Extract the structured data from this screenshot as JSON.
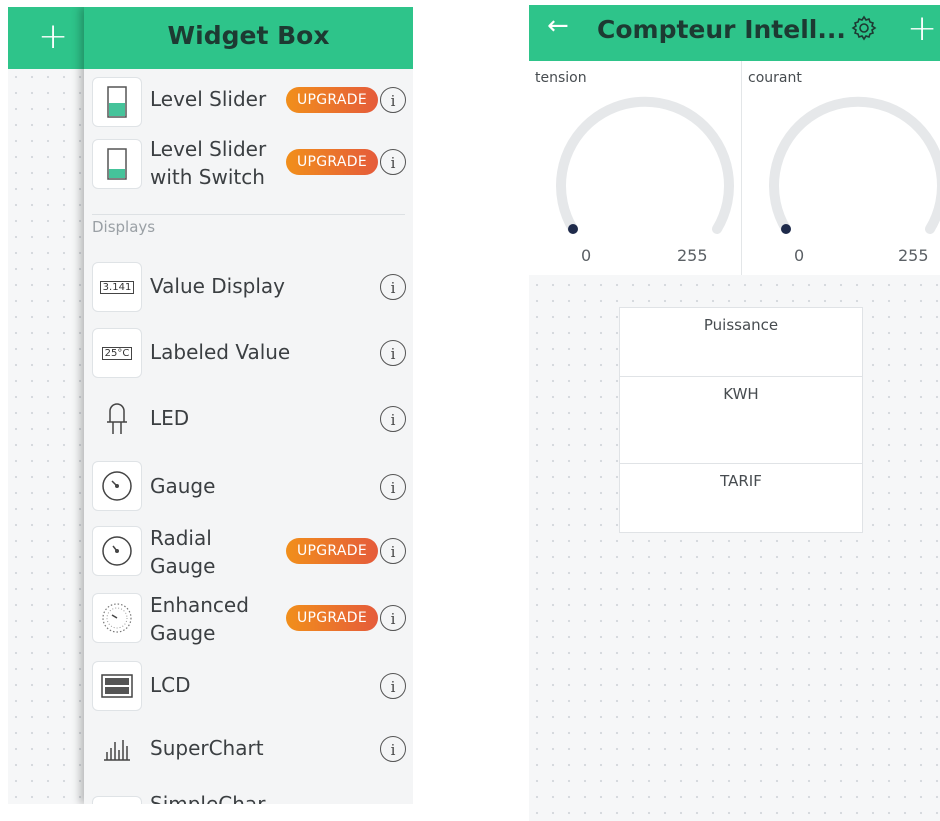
{
  "widget_box": {
    "title": "Widget Box",
    "section_displays": "Displays",
    "widgets": [
      {
        "icon": "level-slider-icon",
        "label": "Level Slider",
        "badge": "UPGRADE"
      },
      {
        "icon": "level-slider-switch-icon",
        "label": "Level Slider\nwith Switch",
        "badge": "UPGRADE"
      },
      {
        "icon": "value-display-icon",
        "icon_text": "3.141",
        "label": "Value Display",
        "badge": ""
      },
      {
        "icon": "labeled-value-icon",
        "icon_text": "25°C",
        "label": "Labeled Value",
        "badge": ""
      },
      {
        "icon": "led-icon",
        "label": "LED",
        "badge": ""
      },
      {
        "icon": "gauge-icon",
        "label": "Gauge",
        "badge": ""
      },
      {
        "icon": "radial-gauge-icon",
        "label": "Radial\nGauge",
        "badge": "UPGRADE"
      },
      {
        "icon": "enhanced-gauge-icon",
        "label": "Enhanced\nGauge",
        "badge": "UPGRADE"
      },
      {
        "icon": "lcd-icon",
        "label": "LCD",
        "badge": ""
      },
      {
        "icon": "superchart-icon",
        "label": "SuperChart",
        "badge": ""
      }
    ],
    "cut_off_label": "SimpleChar",
    "info_glyph": "i"
  },
  "project": {
    "title": "Compteur Intell...",
    "back_icon": "back-arrow-icon",
    "settings_icon": "gear-icon",
    "add_icon": "plus-icon",
    "gauges": [
      {
        "name": "tension",
        "min": "0",
        "max": "255",
        "value_fraction": 0.0
      },
      {
        "name": "courant",
        "min": "0",
        "max": "255",
        "value_fraction": 0.0
      }
    ],
    "value_displays": [
      {
        "name": "Puissance"
      },
      {
        "name": "KWH"
      },
      {
        "name": "TARIF"
      }
    ]
  },
  "colors": {
    "accent": "#2ec48a",
    "title_text": "#1d3a32",
    "badge_start": "#f18f1b",
    "badge_end": "#e55b3b",
    "gauge_track": "#e6e8ea",
    "gauge_dot": "#1e2a4a"
  }
}
